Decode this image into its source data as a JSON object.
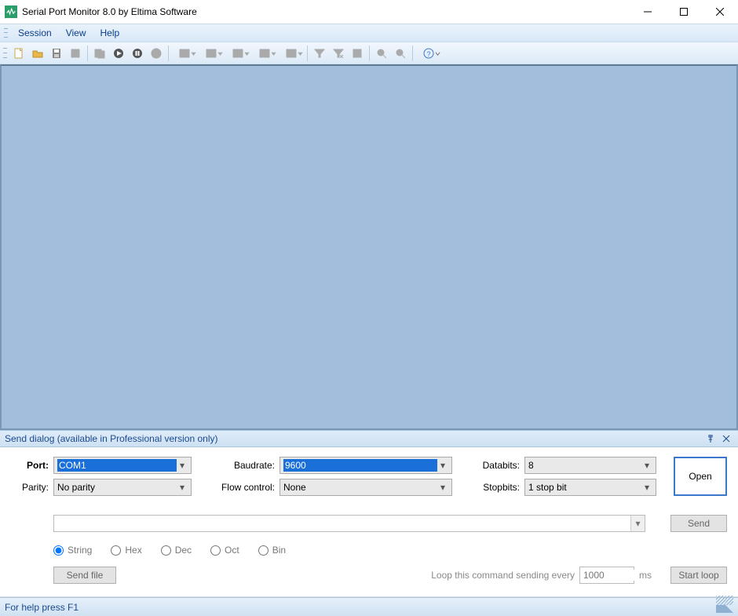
{
  "title": "Serial Port Monitor 8.0 by Eltima Software",
  "menu": {
    "session": "Session",
    "view": "View",
    "help": "Help"
  },
  "panel": {
    "title": "Send dialog (available in Professional version only)"
  },
  "labels": {
    "port": "Port:",
    "baudrate": "Baudrate:",
    "databits": "Databits:",
    "parity": "Parity:",
    "flowcontrol": "Flow control:",
    "stopbits": "Stopbits:",
    "open": "Open",
    "send": "Send",
    "sendfile": "Send file",
    "startloop": "Start loop",
    "loop_text": "Loop this command sending every",
    "ms": "ms"
  },
  "values": {
    "port": "COM1",
    "baudrate": "9600",
    "databits": "8",
    "parity": "No parity",
    "flowcontrol": "None",
    "stopbits": "1 stop bit",
    "loop_ms": "1000"
  },
  "radios": {
    "string": "String",
    "hex": "Hex",
    "dec": "Dec",
    "oct": "Oct",
    "bin": "Bin"
  },
  "status": "For help press F1"
}
